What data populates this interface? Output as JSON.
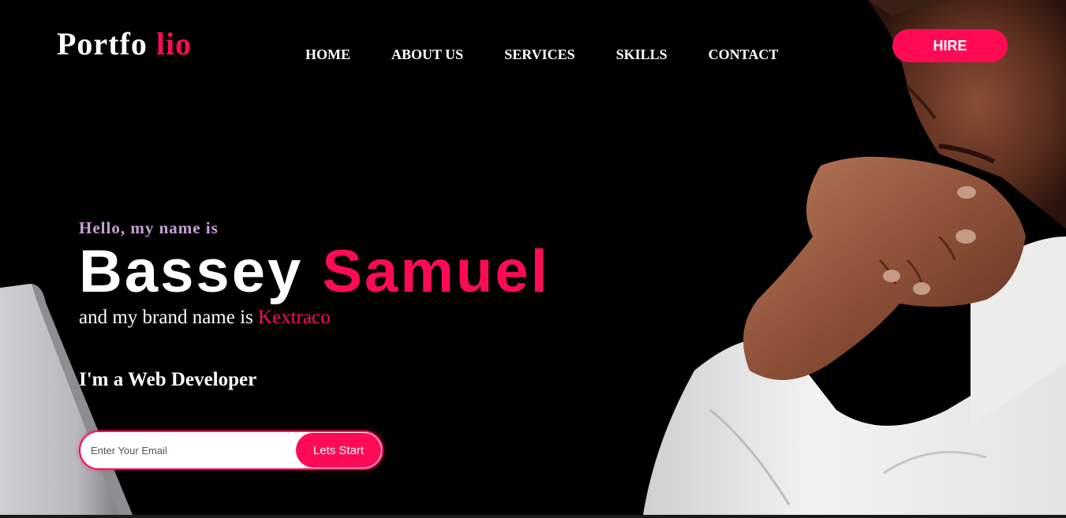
{
  "header": {
    "logo_main": "Portfo",
    "logo_accent": "lio",
    "nav": [
      "HOME",
      "ABOUT US",
      "SERVICES",
      "SKILLS",
      "CONTACT"
    ],
    "hire_label": "HIRE"
  },
  "hero": {
    "greeting": "Hello, my name is",
    "first_name": "Bassey",
    "last_name": "Samuel",
    "brand_prefix": "and my brand name is",
    "brand_name": "Kextraco",
    "role": "I'm a Web Developer"
  },
  "signup": {
    "email_placeholder": "Enter Your Email",
    "email_value": "",
    "button_label": "Lets Start"
  },
  "colors": {
    "accent": "#ff0b55",
    "background": "#000000",
    "greeting": "#c9a0d6"
  },
  "icons": {
    "photo": "man-thinking-at-laptop-photo"
  }
}
